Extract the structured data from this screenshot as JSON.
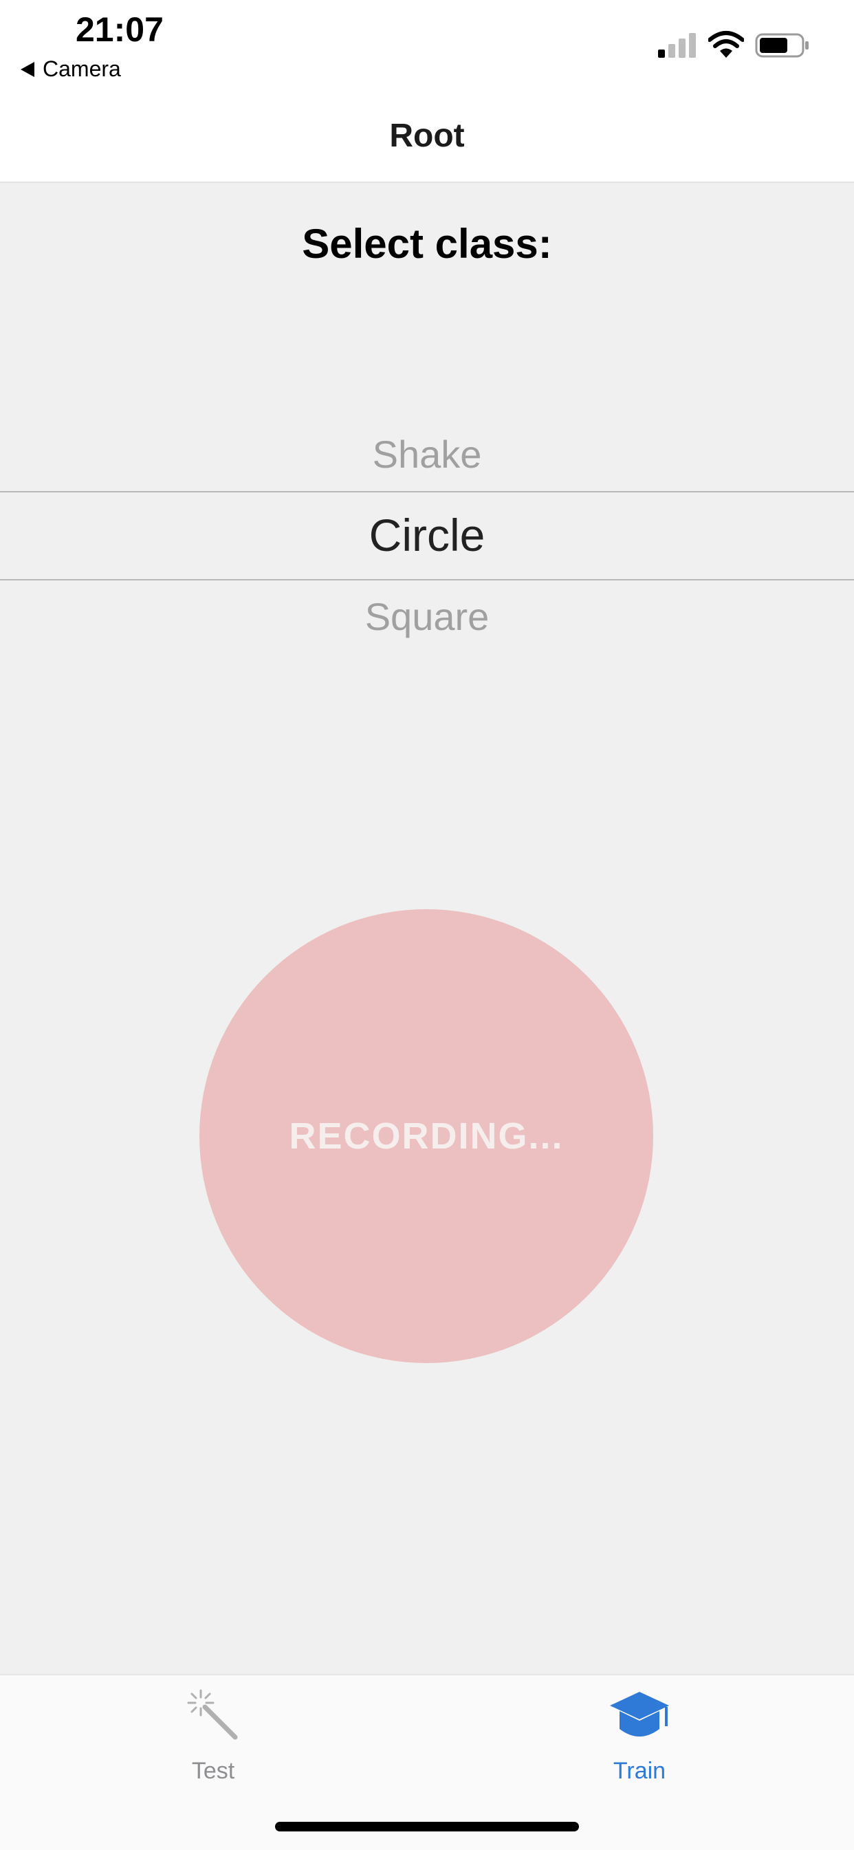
{
  "status_bar": {
    "time": "21:07",
    "back_app": "Camera",
    "signal_icon": "cellular-signal-icon",
    "wifi_icon": "wifi-icon",
    "battery_icon": "battery-icon"
  },
  "nav": {
    "title": "Root"
  },
  "main": {
    "heading": "Select class:",
    "picker": {
      "options": [
        "Shake",
        "Circle",
        "Square"
      ],
      "selected": "Circle"
    },
    "record_button": {
      "label": "RECORDING..."
    }
  },
  "tab_bar": {
    "tabs": [
      {
        "label": "Test",
        "icon": "magic-wand-icon",
        "active": false,
        "color": "#8e8e93"
      },
      {
        "label": "Train",
        "icon": "graduation-cap-icon",
        "active": true,
        "color": "#2f7ad6"
      }
    ]
  },
  "colors": {
    "record_button": "#ecc0c0",
    "accent": "#2f7ad6"
  }
}
